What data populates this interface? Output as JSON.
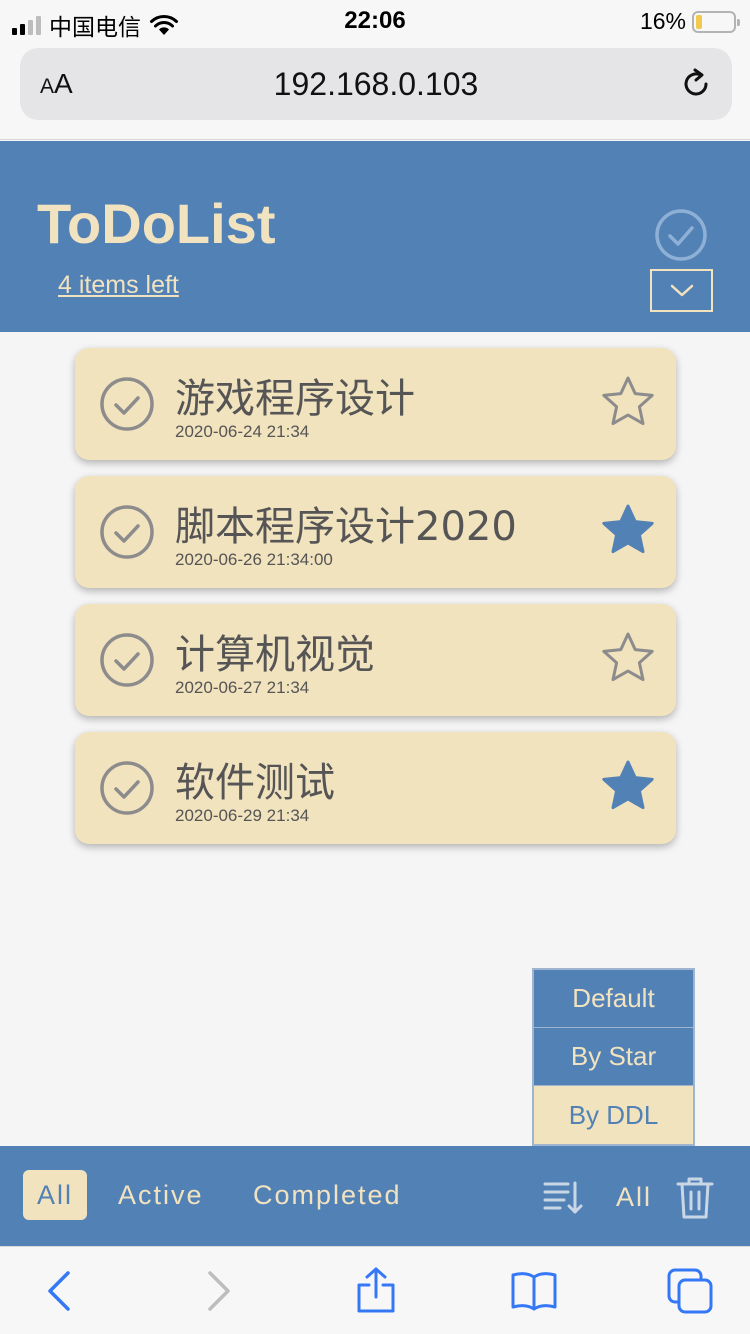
{
  "status_bar": {
    "carrier": "中国电信",
    "time": "22:06",
    "battery": "16%",
    "battery_level": 0.16
  },
  "browser": {
    "text_size_label": "AA",
    "url": "192.168.0.103"
  },
  "header": {
    "title": "ToDoList",
    "items_left": "4 items left"
  },
  "tasks": [
    {
      "title": "游戏程序设计",
      "date": "2020-06-24 21:34",
      "starred": false
    },
    {
      "title": "脚本程序设计2020",
      "date": "2020-06-26 21:34:00",
      "starred": true
    },
    {
      "title": "计算机视觉",
      "date": "2020-06-27 21:34",
      "starred": false
    },
    {
      "title": "软件测试",
      "date": "2020-06-29 21:34",
      "starred": true
    }
  ],
  "sort_menu": {
    "options": [
      "Default",
      "By Star",
      "By DDL"
    ],
    "selected": "By DDL"
  },
  "footer": {
    "filters": [
      "All",
      "Active",
      "Completed"
    ],
    "active_filter": "All",
    "clear_label": "All"
  },
  "colors": {
    "primary": "#5281b5",
    "cream": "#f2e3bf",
    "text_gray": "#555555",
    "ios_blue": "#3478f6"
  }
}
